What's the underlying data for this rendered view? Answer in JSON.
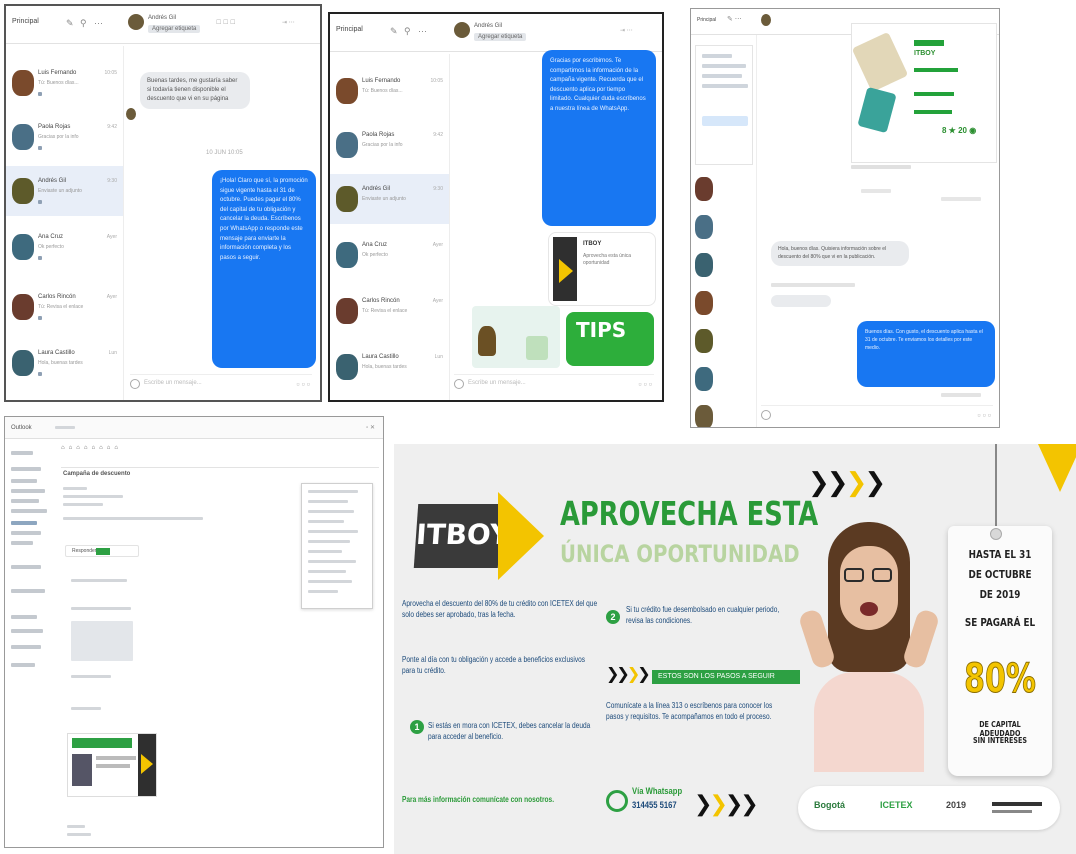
{
  "messenger": {
    "folder_label": "Principal",
    "compose_placeholder": "Escribe un mensaje...",
    "contacts": [
      {
        "name": "Luis Fernando",
        "sub": "Tú: Buenos días...",
        "time": "10:05"
      },
      {
        "name": "Paola Rojas",
        "sub": "Gracias por la info",
        "time": "9:42"
      },
      {
        "name": "Andrés Gil",
        "sub": "Enviaste un adjunto",
        "time": "9:30"
      },
      {
        "name": "Ana Cruz",
        "sub": "Ok perfecto",
        "time": "Ayer"
      },
      {
        "name": "Carlos Rincón",
        "sub": "Tú: Revisa el enlace",
        "time": "Ayer"
      },
      {
        "name": "Laura Castillo",
        "sub": "Hola, buenas tardes",
        "time": "Lun"
      }
    ]
  },
  "panel1": {
    "header_name": "Andrés Gil",
    "header_tag": "Agregar etiqueta",
    "incoming": "Buenas tardes, me gustaría saber si todavía tienen disponible el descuento que vi en su página",
    "date_sep": "10 JUN 10:05",
    "outgoing": "¡Hola! Claro que sí, la promoción sigue vigente hasta el 31 de octubre. Puedes pagar el 80% del capital de tu obligación y cancelar la deuda. Escríbenos por WhatsApp o responde este mensaje para enviarte la información completa y los pasos a seguir."
  },
  "panel2": {
    "header_name": "Andrés Gil",
    "header_tag": "Agregar etiqueta",
    "outgoing": "Gracias por escribirnos. Te compartimos la información de la campaña vigente. Recuerda que el descuento aplica por tiempo limitado. Cualquier duda escríbenos a nuestra línea de WhatsApp.",
    "tips_label": "TIPS",
    "link_title": "ITBOY",
    "link_sub": "Aprovecha esta única oportunidad"
  },
  "panel3": {
    "card_title": "ITBOY",
    "incoming": "Hola, buenos días. Quisiera información sobre el descuento del 80% que vi en la publicación.",
    "outgoing": "Buenos días. Con gusto, el descuento aplica hasta el 31 de octubre. Te enviamos los detalles por este medio."
  },
  "panel4": {
    "toolbar_title": "Outlook",
    "subject": "Campaña de descuento",
    "button_label": "Responder"
  },
  "ad": {
    "brand": "ITBOY",
    "title_line1": "APROVECHA ESTA",
    "title_line2": "ÚNICA OPORTUNIDAD",
    "para1": "Aprovecha el descuento del 80% de tu crédito con ICETEX del que solo debes ser aprobado, tras la fecha.",
    "para2": "Ponte al día con tu obligación y accede a beneficios exclusivos para tu crédito.",
    "item1": "Si estás en mora con ICETEX, debes cancelar la deuda para acceder al beneficio.",
    "item2": "Si tu crédito fue desembolsado en cualquier periodo, revisa las condiciones.",
    "strip": "ESTOS SON LOS PASOS A SEGUIR",
    "para3": "Comunícate a la línea 313 o escríbenos para conocer los pasos y requisitos. Te acompañamos en todo el proceso.",
    "footer_note": "Para más información comunícate con nosotros.",
    "whatsapp_label": "Vía Whatsapp",
    "whatsapp_number": "314455 5167",
    "tag_line1": "HASTA EL 31",
    "tag_line2": "DE OCTUBRE",
    "tag_line3": "DE 2019",
    "tag_line4": "SE PAGARÁ EL",
    "tag_big": "80%",
    "tag_line5": "DE CAPITAL ADEUDADO",
    "tag_line6": "SIN INTERESES",
    "logo1": "Bogotá",
    "logo2": "ICETEX",
    "logo3": "2019"
  },
  "colors": {
    "messenger_blue": "#1877f2",
    "brand_green": "#2a9a38",
    "brand_yellow": "#f3c400",
    "dark_gray": "#3a3a3a"
  }
}
